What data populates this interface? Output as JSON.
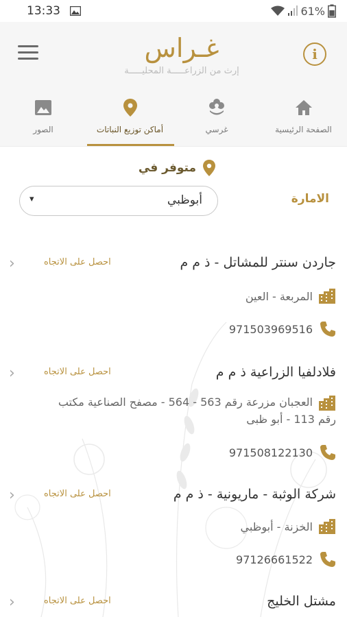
{
  "status_bar": {
    "time": "13:33",
    "battery": "61%"
  },
  "header": {
    "logo": "غـراس",
    "tagline": "إرث من الزراعـــــة المحليـــــة",
    "info_glyph": "i"
  },
  "tabs": [
    {
      "label": "الصفحة الرئيسية",
      "icon": "home-icon"
    },
    {
      "label": "غرسي",
      "icon": "flower-icon"
    },
    {
      "label": "أماكن توزيع النباتات",
      "icon": "location-pin-icon"
    },
    {
      "label": "الصور",
      "icon": "image-icon"
    }
  ],
  "filter": {
    "available_label": "متوفر في",
    "emirate_label": "الامارة",
    "emirate_value": "أبوظبي",
    "caret": "▾"
  },
  "stores": [
    {
      "name": "جاردن سنتر للمشاتل - ذ م م",
      "directions": "احصل على الاتجاه",
      "address": "المربعة - العين",
      "phone": "971503969516"
    },
    {
      "name": "فلادلفيا الزراعية ذ م م",
      "directions": "احصل على الاتجاه",
      "address_line1": "العجبان مزرعة رقم 563 - 564 - مصفح الصناعية مكتب",
      "address_line2": "رقم 113 - أبو ظبى",
      "phone": "971508122130"
    },
    {
      "name": "شركة الوثبة - ماريونية - ذ م م",
      "directions": "احصل على الاتجاه",
      "address": "الخزنة - أبوظبي",
      "phone": "97126661522"
    },
    {
      "name": "مشتل الخليج",
      "directions": "احصل على الاتجاه"
    }
  ],
  "chevron": "‹",
  "colors": {
    "accent": "#b8913e",
    "header_bg": "#f6f6f6"
  }
}
